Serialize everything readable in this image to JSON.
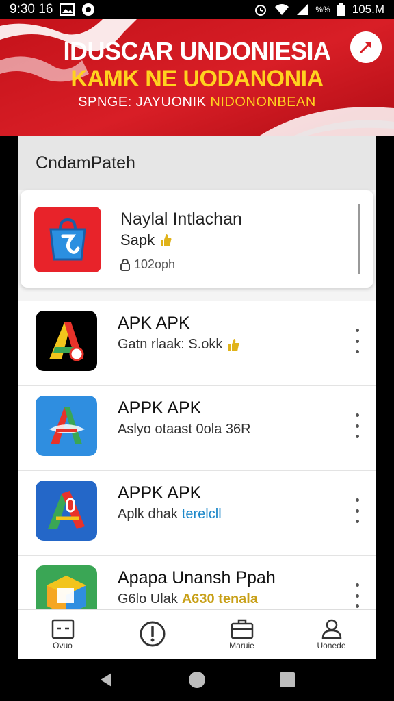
{
  "status_bar": {
    "time": "9:30 16",
    "battery": "105.M",
    "signal_text": "%%"
  },
  "banner": {
    "title_line1": "IDUSCAR UNDONIESIA",
    "title_line2": "KAMK NE UODANONIA",
    "subtitle_prefix": "SPNGE: JAYUONIK",
    "subtitle_highlight": "NIDONONBEAN",
    "colors": {
      "red": "#d81e26",
      "gold": "#ffd21f"
    },
    "action_icon": "pin-arrow-icon"
  },
  "section": {
    "title": "CndamPateh"
  },
  "featured": {
    "title": "Naylal Intlachan",
    "subtitle": "Sapk",
    "size": "102oph",
    "icon": "app-bag-icon"
  },
  "items": [
    {
      "title": "APK APK",
      "subtitle": "Gatn rlaak: S.okk",
      "subtitle_accent": "",
      "icon": "apk-letter-a-dark-icon"
    },
    {
      "title": "APPK APK",
      "subtitle": "Aslyo otaast 0ola 36R",
      "subtitle_accent": "",
      "icon": "apk-letter-a-blue-icon"
    },
    {
      "title": "APPK APK",
      "subtitle": "Aplk dhak",
      "subtitle_accent": "terelcll",
      "icon": "apk-letter-a-navy-icon"
    },
    {
      "title": "Apapa Unansh Ppah",
      "subtitle": "G6lo Ulak",
      "subtitle_accent": "A630 tenala",
      "icon": "apk-cube-green-icon"
    }
  ],
  "bottom_nav": [
    {
      "label": "Ovuo",
      "icon": "apps-grid-icon"
    },
    {
      "label": "",
      "icon": "info-circle-icon"
    },
    {
      "label": "Maruie",
      "icon": "briefcase-icon"
    },
    {
      "label": "Uonede",
      "icon": "person-icon"
    }
  ]
}
